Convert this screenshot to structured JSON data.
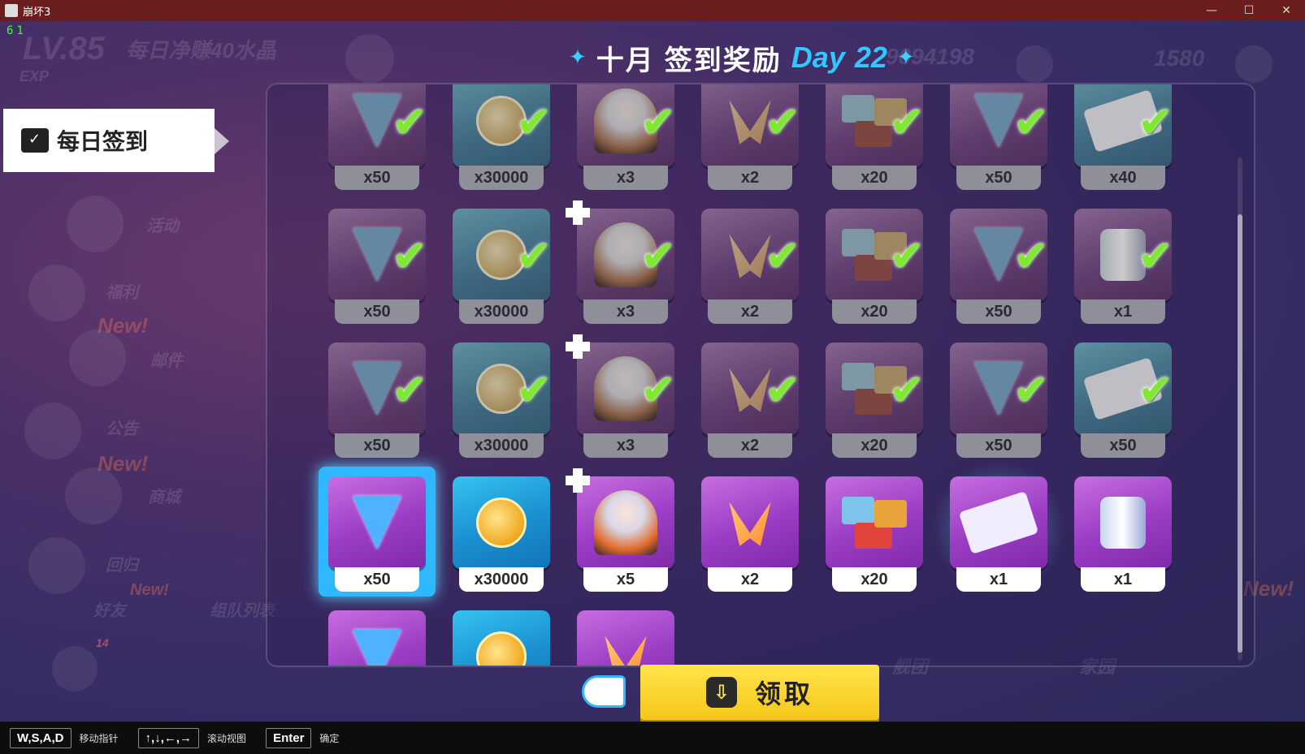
{
  "window": {
    "title": "崩坏3",
    "fps": "61"
  },
  "background": {
    "level": "LV.85",
    "daily_earn": "每日净赚40水晶",
    "exp": "EXP",
    "currency_1": "9094198",
    "currency_2": "1580",
    "menu": [
      "活动",
      "福利",
      "邮件",
      "公告",
      "商城",
      "回归",
      "好友",
      "组队列表",
      "舰团",
      "家园"
    ],
    "new_badge": "New!",
    "badge_count": "14"
  },
  "header": {
    "month": "十月",
    "title": "签到奖励",
    "day_label": "Day",
    "day_number": "22"
  },
  "sidebar": {
    "tab_label": "每日签到"
  },
  "rewards": {
    "rows": [
      [
        {
          "item": "crystal",
          "qty": "x50",
          "color": "purple",
          "claimed": true
        },
        {
          "item": "coin",
          "qty": "x30000",
          "color": "blue",
          "claimed": true
        },
        {
          "item": "character",
          "qty": "x3",
          "color": "purple",
          "claimed": true
        },
        {
          "item": "shard",
          "qty": "x2",
          "color": "purple",
          "claimed": true
        },
        {
          "item": "blocks",
          "qty": "x20",
          "color": "purple",
          "claimed": true
        },
        {
          "item": "crystal",
          "qty": "x50",
          "color": "purple",
          "claimed": true
        },
        {
          "item": "card",
          "qty": "x40",
          "color": "blue",
          "claimed": true
        }
      ],
      [
        {
          "item": "crystal",
          "qty": "x50",
          "color": "purple",
          "claimed": true
        },
        {
          "item": "coin",
          "qty": "x30000",
          "color": "blue",
          "claimed": true
        },
        {
          "item": "character",
          "qty": "x3",
          "color": "purple",
          "claimed": true,
          "puzzle": true
        },
        {
          "item": "shard",
          "qty": "x2",
          "color": "purple",
          "claimed": true
        },
        {
          "item": "blocks",
          "qty": "x20",
          "color": "purple",
          "claimed": true
        },
        {
          "item": "crystal",
          "qty": "x50",
          "color": "purple",
          "claimed": true
        },
        {
          "item": "can",
          "qty": "x1",
          "color": "purple",
          "claimed": true
        }
      ],
      [
        {
          "item": "crystal",
          "qty": "x50",
          "color": "purple",
          "claimed": true
        },
        {
          "item": "coin",
          "qty": "x30000",
          "color": "blue",
          "claimed": true
        },
        {
          "item": "character",
          "qty": "x3",
          "color": "purple",
          "claimed": true,
          "puzzle": true
        },
        {
          "item": "shard",
          "qty": "x2",
          "color": "purple",
          "claimed": true
        },
        {
          "item": "blocks",
          "qty": "x20",
          "color": "purple",
          "claimed": true
        },
        {
          "item": "crystal",
          "qty": "x50",
          "color": "purple",
          "claimed": true
        },
        {
          "item": "card",
          "qty": "x50",
          "color": "blue",
          "claimed": true
        }
      ],
      [
        {
          "item": "crystal",
          "qty": "x50",
          "color": "purple",
          "claimed": false,
          "selected": true
        },
        {
          "item": "coin",
          "qty": "x30000",
          "color": "blue",
          "claimed": false
        },
        {
          "item": "character",
          "qty": "x5",
          "color": "purple",
          "claimed": false,
          "puzzle": true
        },
        {
          "item": "shard",
          "qty": "x2",
          "color": "purple",
          "claimed": false
        },
        {
          "item": "blocks",
          "qty": "x20",
          "color": "purple",
          "claimed": false
        },
        {
          "item": "card",
          "qty": "x1",
          "color": "purple",
          "claimed": false,
          "glow": true
        },
        {
          "item": "can",
          "qty": "x1",
          "color": "purple",
          "claimed": false
        }
      ],
      [
        {
          "item": "crystal",
          "qty": "",
          "color": "purple",
          "claimed": false
        },
        {
          "item": "coin",
          "qty": "",
          "color": "blue",
          "claimed": false
        },
        {
          "item": "shard",
          "qty": "",
          "color": "purple",
          "claimed": false
        }
      ]
    ]
  },
  "claim_button": {
    "label": "领取"
  },
  "hints": [
    {
      "key": "W,S,A,D",
      "label": "移动指针"
    },
    {
      "key": "↑,↓,←,→",
      "label": "滚动视图"
    },
    {
      "key": "Enter",
      "label": "确定"
    }
  ]
}
